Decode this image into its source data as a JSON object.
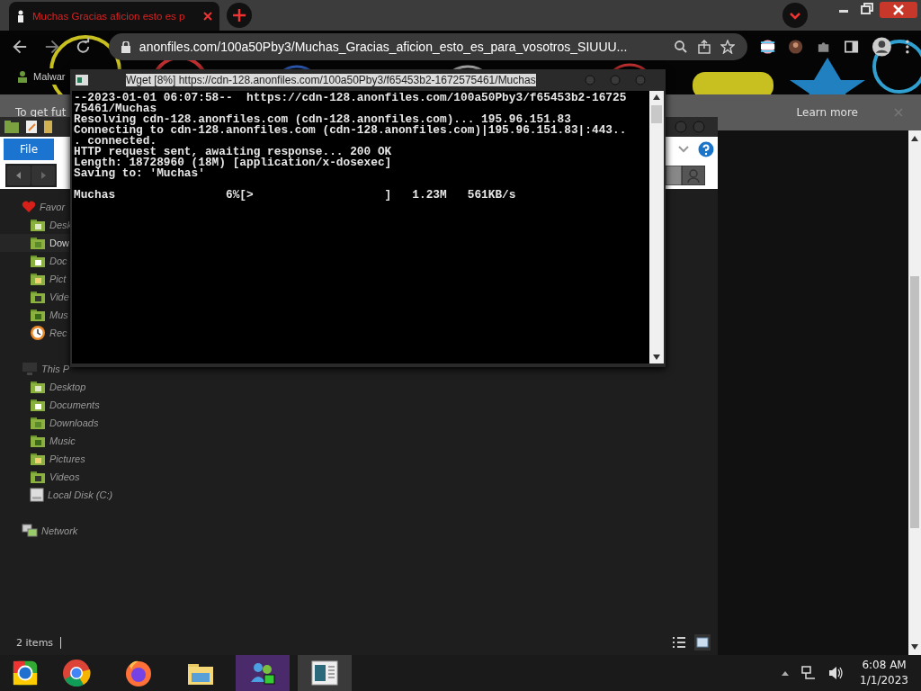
{
  "browser": {
    "tabs": [
      {
        "title": "Muchas Gracias aficion esto es p",
        "selected": true
      }
    ],
    "address": "anonfiles.com/100a50Pby3/Muchas_Gracias_aficion_esto_es_para_vosotros_SIUUU...",
    "bookmarks": [
      "Malwar"
    ],
    "infobar": {
      "text": "To get fut",
      "link": "Learn more"
    }
  },
  "explorer": {
    "ribbon_tab": "File",
    "sidebar": [
      {
        "label": "Favor",
        "kind": "favorites",
        "selected": false,
        "children": [
          {
            "label": "Desk",
            "kind": "desktop",
            "selected": false
          },
          {
            "label": "Dow",
            "kind": "downloads",
            "selected": true
          },
          {
            "label": "Doc",
            "kind": "documents",
            "selected": false
          },
          {
            "label": "Pict",
            "kind": "pictures",
            "selected": false
          },
          {
            "label": "Vide",
            "kind": "videos",
            "selected": false
          },
          {
            "label": "Mus",
            "kind": "music",
            "selected": false
          },
          {
            "label": "Rec",
            "kind": "recent",
            "selected": false
          }
        ]
      },
      {
        "label": "This P",
        "kind": "pc",
        "selected": false,
        "children": [
          {
            "label": "Desktop",
            "kind": "desktop",
            "selected": false
          },
          {
            "label": "Documents",
            "kind": "documents",
            "selected": false
          },
          {
            "label": "Downloads",
            "kind": "downloads",
            "selected": false
          },
          {
            "label": "Music",
            "kind": "music",
            "selected": false
          },
          {
            "label": "Pictures",
            "kind": "pictures",
            "selected": false
          },
          {
            "label": "Videos",
            "kind": "videos",
            "selected": false
          },
          {
            "label": "Local Disk (C:)",
            "kind": "disk",
            "selected": false
          }
        ]
      },
      {
        "label": "Network",
        "kind": "network",
        "selected": false
      }
    ],
    "status": "2 items"
  },
  "console": {
    "title": "Wget [8%] https://cdn-128.anonfiles.com/100a50Pby3/f65453b2-1672575461/Muchas",
    "lines": [
      "--2023-01-01 06:07:58--  https://cdn-128.anonfiles.com/100a50Pby3/f65453b2-16725",
      "75461/Muchas",
      "Resolving cdn-128.anonfiles.com (cdn-128.anonfiles.com)... 195.96.151.83",
      "Connecting to cdn-128.anonfiles.com (cdn-128.anonfiles.com)|195.96.151.83|:443..",
      ". connected.",
      "HTTP request sent, awaiting response... 200 OK",
      "Length: 18728960 (18M) [application/x-dosexec]",
      "Saving to: 'Muchas'"
    ],
    "progress": "Muchas                6%[>                   ]   1.23M   561KB/s"
  },
  "taskbar": {
    "apps": [
      {
        "kind": "chromium",
        "selected": false
      },
      {
        "kind": "chrome",
        "selected": false
      },
      {
        "kind": "firefox",
        "selected": false
      },
      {
        "kind": "folder",
        "selected": false
      },
      {
        "kind": "messenger",
        "selected": false
      },
      {
        "kind": "console",
        "selected": true
      }
    ],
    "time": "6:08 AM",
    "date": "1/1/2023"
  }
}
